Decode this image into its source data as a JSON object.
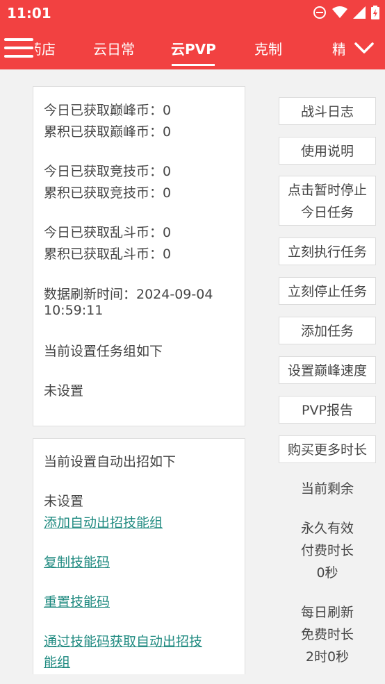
{
  "status": {
    "time": "11:01"
  },
  "tabs": [
    {
      "label": "药店",
      "visible": "药店"
    },
    {
      "label": "云日常"
    },
    {
      "label": "云PVP"
    },
    {
      "label": "克制"
    },
    {
      "label": "精"
    }
  ],
  "stats": {
    "peak_today": "今日已获取巅峰币：0",
    "peak_total": "累积已获取巅峰币：0",
    "arena_today": "今日已获取竞技币：0",
    "arena_total": "累积已获取竞技币：0",
    "brawl_today": "今日已获取乱斗币：0",
    "brawl_total": "累积已获取乱斗币：0",
    "refresh_line1": "数据刷新时间：2024-09-04",
    "refresh_line2": "10:59:11",
    "task_group_title": "当前设置任务组如下",
    "task_group_value": "未设置"
  },
  "auto_skill": {
    "title": "当前设置自动出招如下",
    "value": "未设置",
    "link_add": "添加自动出招技能组",
    "link_copy": "复制技能码",
    "link_reset": "重置技能码",
    "link_import_line1": "通过技能码获取自动出招技",
    "link_import_line2": "能组"
  },
  "side": {
    "battle_log": "战斗日志",
    "usage": "使用说明",
    "pause_line1": "点击暂时停止",
    "pause_line2": "今日任务",
    "run_now": "立刻执行任务",
    "stop_now": "立刻停止任务",
    "add_task": "添加任务",
    "set_speed": "设置巅峰速度",
    "pvp_report": "PVP报告",
    "buy_time": "购买更多时长",
    "remaining_label": "当前剩余",
    "permanent_line1": "永久有效",
    "permanent_line2": "付费时长",
    "permanent_value": "0秒",
    "daily_line1": "每日刷新",
    "daily_line2": "免费时长",
    "daily_value": "2时0秒"
  }
}
